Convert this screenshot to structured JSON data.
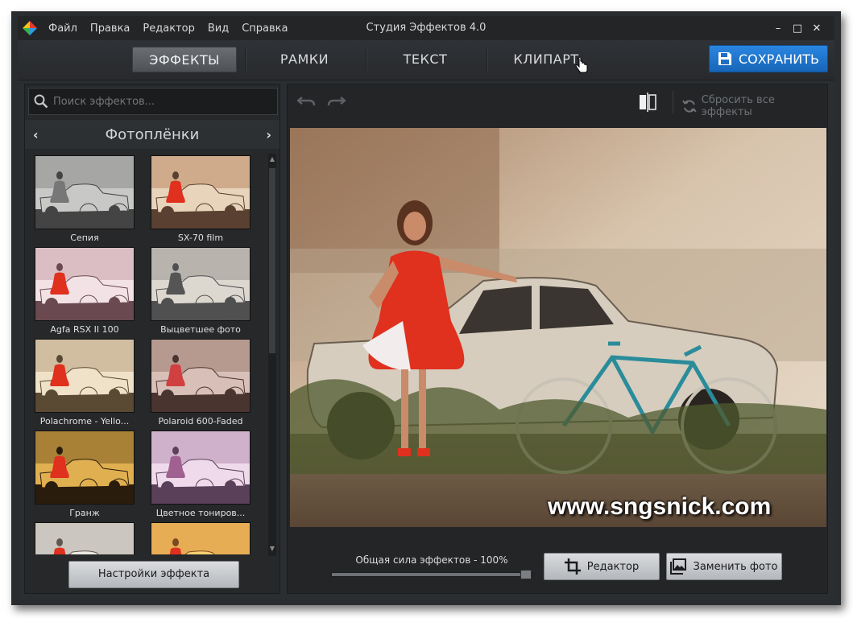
{
  "window": {
    "title": "Студия Эффектов 4.0",
    "menu": [
      "Файл",
      "Правка",
      "Редактор",
      "Вид",
      "Справка"
    ],
    "controls": {
      "minimize": "–",
      "maximize": "□",
      "close": "✕"
    }
  },
  "tabs": [
    {
      "label": "ЭФФЕКТЫ",
      "active": true
    },
    {
      "label": "РАМКИ",
      "active": false
    },
    {
      "label": "ТЕКСТ",
      "active": false
    },
    {
      "label": "КЛИПАРТ",
      "active": false
    }
  ],
  "save_button": {
    "label": "СОХРАНИТЬ"
  },
  "left_panel": {
    "search_placeholder": "Поиск эффектов...",
    "category": {
      "title": "Фотоплёнки",
      "prev": "‹",
      "next": "›"
    },
    "effects": [
      {
        "label": "Сепия",
        "tone": "sepia"
      },
      {
        "label": "SX-70 film",
        "tone": "sx70"
      },
      {
        "label": "Agfa RSX II 100",
        "tone": "agfa"
      },
      {
        "label": "Выцветшее фото",
        "tone": "faded"
      },
      {
        "label": "Polachrome - Yello...",
        "tone": "yellow"
      },
      {
        "label": "Polaroid 600-Faded",
        "tone": "polaroid"
      },
      {
        "label": "Гранж",
        "tone": "grunge"
      },
      {
        "label": "Цветное тониров...",
        "tone": "tinted"
      },
      {
        "label": "",
        "tone": "light"
      },
      {
        "label": "",
        "tone": "warm"
      }
    ],
    "settings_button": "Настройки эффекта"
  },
  "right_panel": {
    "reset_label": "Сбросить все эффекты",
    "watermark": "www.sngsnick.com",
    "strength": {
      "label": "Общая сила эффектов - 100%",
      "value": 100
    },
    "editor_button": "Редактор",
    "replace_button": "Заменить фото"
  },
  "colors": {
    "accent": "#1e74cc",
    "background": "#2b2e31",
    "panel": "#262829",
    "dress": "#e0301e"
  }
}
